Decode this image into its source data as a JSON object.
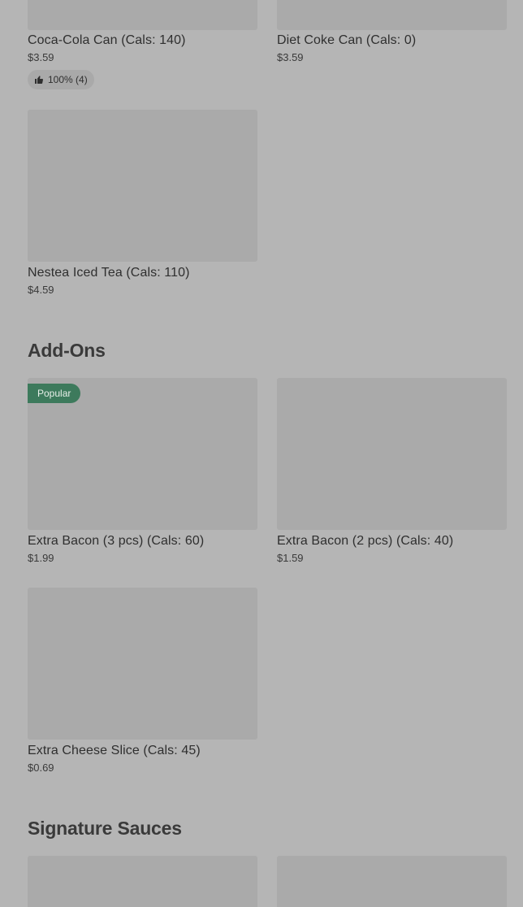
{
  "drinks": {
    "items": [
      {
        "name": "Coca-Cola Can (Cals: 140)",
        "price": "$3.59",
        "rating": "100% (4)"
      },
      {
        "name": "Diet Coke Can (Cals: 0)",
        "price": "$3.59"
      },
      {
        "name": "Nestea Iced Tea (Cals: 110)",
        "price": "$4.59"
      }
    ]
  },
  "addons": {
    "title": "Add-Ons",
    "badge": "Popular",
    "items": [
      {
        "name": "Extra Bacon (3 pcs) (Cals: 60)",
        "price": "$1.99"
      },
      {
        "name": "Extra Bacon (2 pcs) (Cals: 40)",
        "price": "$1.59"
      },
      {
        "name": "Extra Cheese Slice (Cals: 45)",
        "price": "$0.69"
      }
    ]
  },
  "sauces": {
    "title": "Signature Sauces"
  },
  "icons": {
    "rating": "thumbs-up-icon"
  },
  "colors": {
    "badge": "#3d7a5c",
    "background": "#b5b5b5",
    "image_placeholder": "#aaaaaa"
  }
}
